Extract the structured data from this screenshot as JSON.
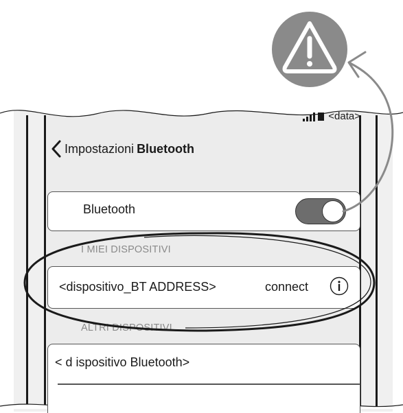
{
  "status_bar": {
    "time_placeholder": "<data>"
  },
  "nav": {
    "back_label": "Impostazioni",
    "title": "Bluetooth"
  },
  "bluetooth": {
    "label": "Bluetooth",
    "enabled": true
  },
  "sections": {
    "my_devices": "I MIEI DISPOSITIVI",
    "other_devices": "ALTRI DISPOSITIVI"
  },
  "my_devices": [
    {
      "name": "<dispositivo_BT ADDRESS>",
      "status": "connect"
    }
  ],
  "other_devices": [
    {
      "name": "< d ispositivo Bluetooth>"
    }
  ],
  "icons": {
    "warning": "warning-triangle-icon",
    "info": "info-icon",
    "back": "chevron-left-icon"
  },
  "colors": {
    "warning_bg": "#8a8a8a",
    "toggle_on": "#6d6d6d"
  }
}
